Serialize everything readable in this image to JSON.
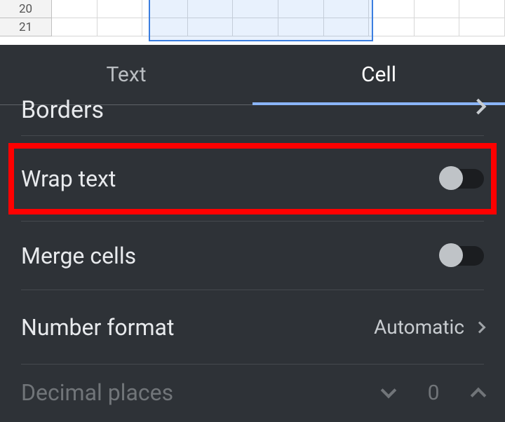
{
  "sheet": {
    "rows": [
      "20",
      "21"
    ]
  },
  "panel": {
    "tabs": [
      {
        "label": "Text",
        "active": false
      },
      {
        "label": "Cell",
        "active": true
      }
    ],
    "borders": {
      "label": "Borders"
    },
    "wrap": {
      "label": "Wrap text",
      "on": false
    },
    "merge": {
      "label": "Merge cells",
      "on": false
    },
    "numfmt": {
      "label": "Number format",
      "value": "Automatic"
    },
    "decimals": {
      "label": "Decimal places",
      "value": "0"
    }
  }
}
